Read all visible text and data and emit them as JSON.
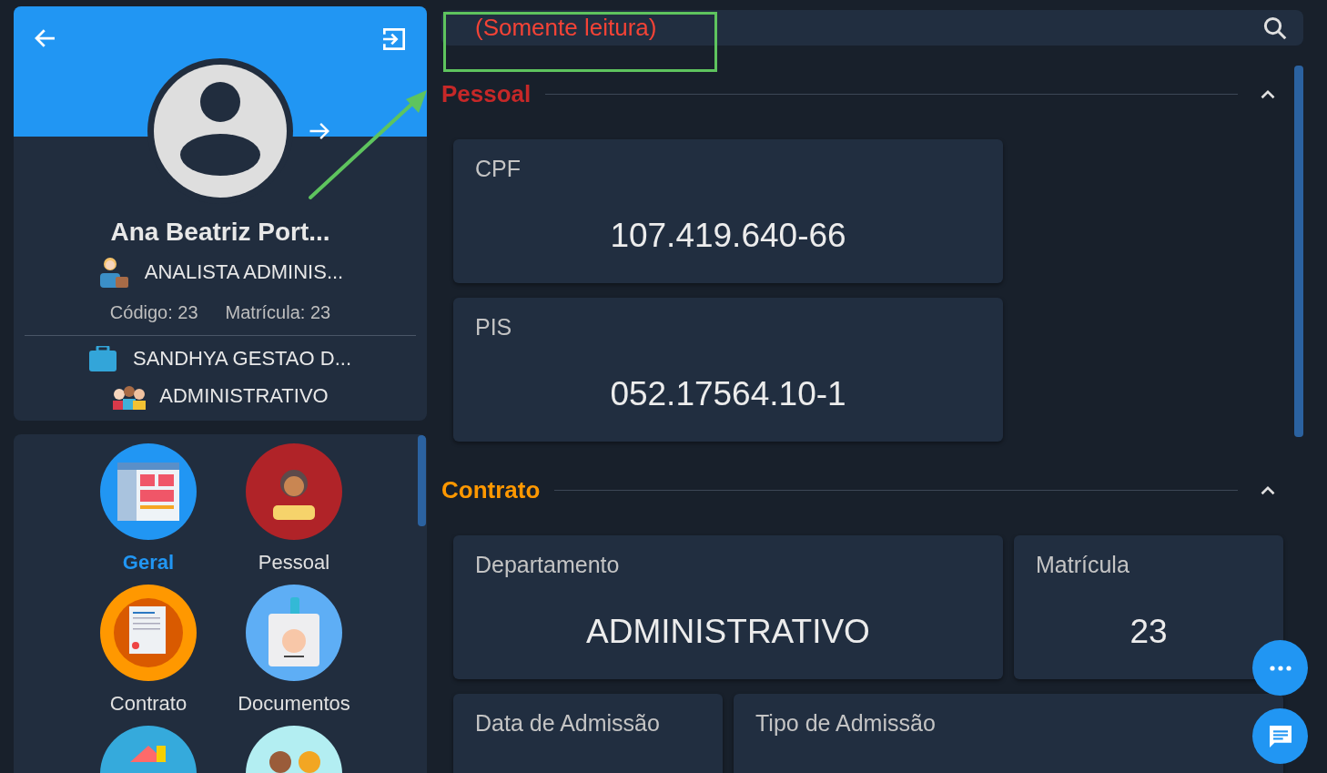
{
  "profile": {
    "name": "Ana Beatriz Port...",
    "role": "ANALISTA ADMINIS...",
    "code": "Código: 23",
    "registration": "Matrícula: 23",
    "company": "SANDHYA GESTAO D...",
    "department": "ADMINISTRATIVO"
  },
  "menu": [
    {
      "label": "Geral",
      "kind": "general",
      "selected": true
    },
    {
      "label": "Pessoal",
      "kind": "personal",
      "selected": false
    },
    {
      "label": "Contrato",
      "kind": "contract",
      "selected": false
    },
    {
      "label": "Documentos",
      "kind": "documents",
      "selected": false
    },
    {
      "kind": "address"
    },
    {
      "kind": "family"
    }
  ],
  "header": {
    "title": "(Somente leitura)"
  },
  "sections": [
    {
      "title": "Pessoal",
      "color": "#c62828",
      "expanded": true,
      "kind": "stacked",
      "fields": [
        {
          "label": "CPF",
          "value": "107.419.640-66"
        },
        {
          "label": "PIS",
          "value": "052.17564.10-1"
        }
      ]
    },
    {
      "title": "Contrato",
      "color": "#ff9800",
      "expanded": true,
      "kind": "grid",
      "fields": [
        {
          "label": "Departamento",
          "value": "ADMINISTRATIVO"
        },
        {
          "label": "Matrícula",
          "value": "23"
        },
        {
          "label": "Data de Admissão"
        },
        {
          "label": "Tipo de Admissão"
        }
      ]
    }
  ]
}
